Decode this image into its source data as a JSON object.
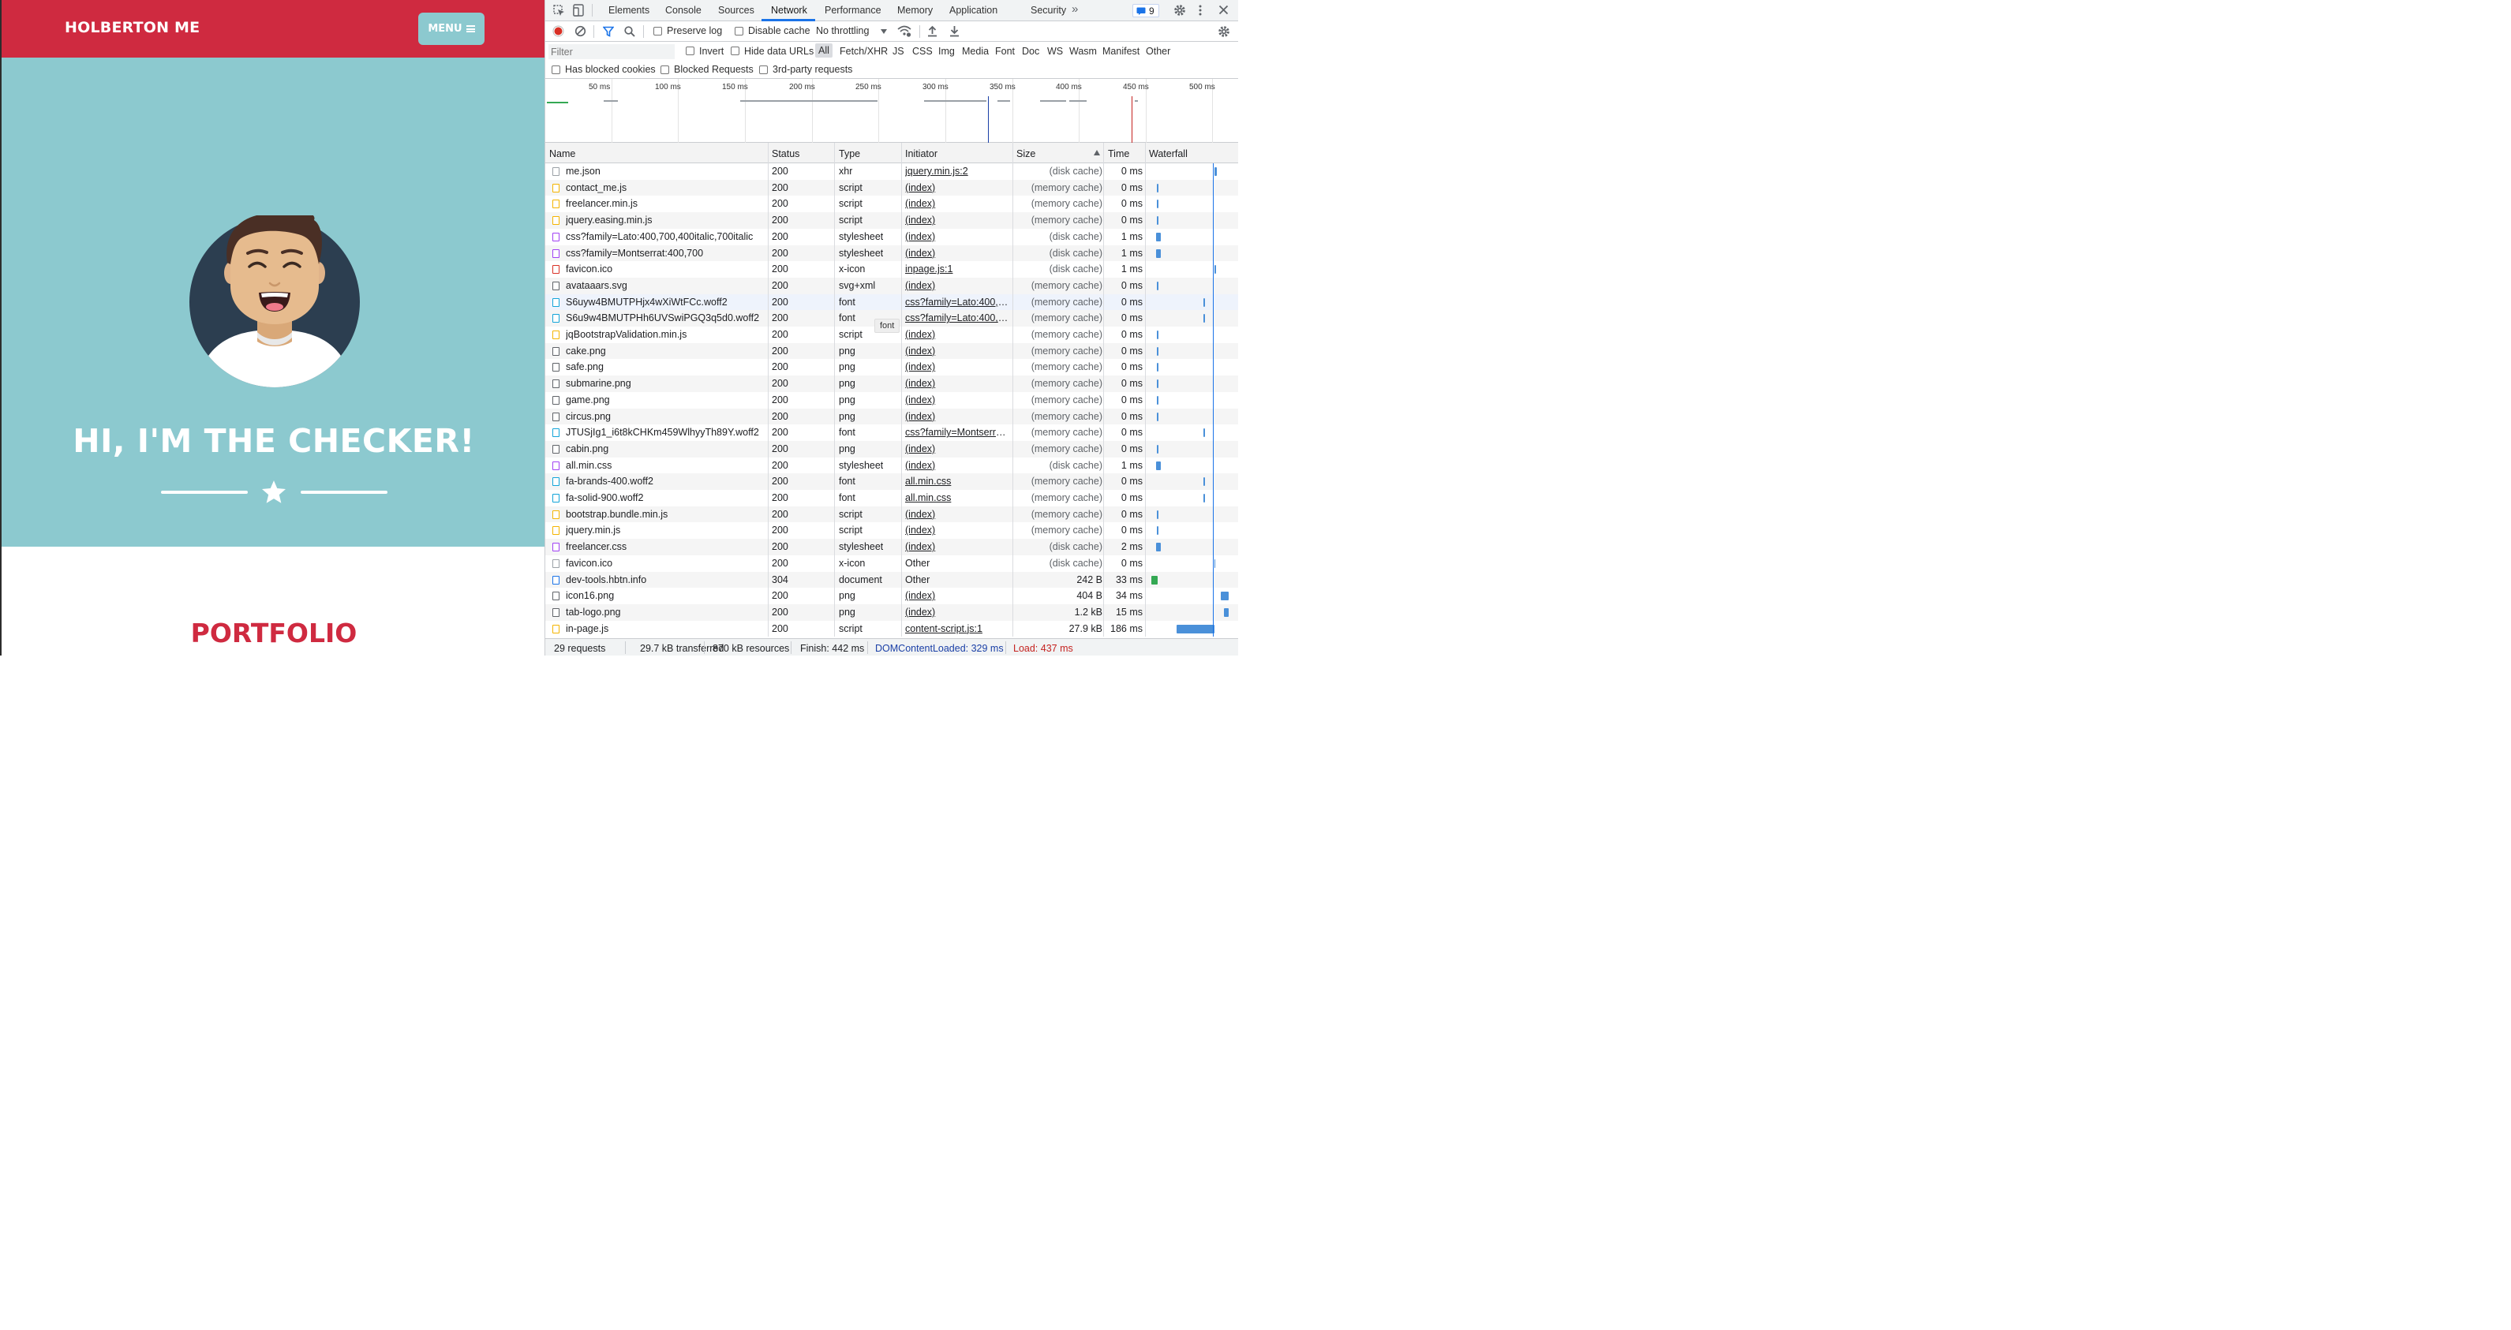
{
  "site": {
    "brand": "HOLBERTON ME",
    "menu_label": "MENU",
    "hero_title": "HI, I'M THE CHECKER!",
    "portfolio_title": "PORTFOLIO",
    "colors": {
      "primary": "#cf2a40",
      "hero_bg": "#8cc9cf"
    }
  },
  "devtools": {
    "tabs": [
      "Elements",
      "Console",
      "Sources",
      "Network",
      "Performance",
      "Memory",
      "Application",
      "Security"
    ],
    "active_tab": "Network",
    "issues_count": "9",
    "toolbar": {
      "preserve_log": "Preserve log",
      "disable_cache": "Disable cache",
      "throttling": "No throttling"
    },
    "filter": {
      "placeholder": "Filter",
      "invert": "Invert",
      "hide_data_urls": "Hide data URLs",
      "types": [
        "All",
        "Fetch/XHR",
        "JS",
        "CSS",
        "Img",
        "Media",
        "Font",
        "Doc",
        "WS",
        "Wasm",
        "Manifest",
        "Other"
      ],
      "has_blocked_cookies": "Has blocked cookies",
      "blocked_requests": "Blocked Requests",
      "third_party": "3rd-party requests"
    },
    "overview_ticks": [
      "50 ms",
      "100 ms",
      "150 ms",
      "200 ms",
      "250 ms",
      "300 ms",
      "350 ms",
      "400 ms",
      "450 ms",
      "500 ms"
    ],
    "columns": {
      "name": "Name",
      "status": "Status",
      "type": "Type",
      "initiator": "Initiator",
      "size": "Size",
      "time": "Time",
      "waterfall": "Waterfall"
    },
    "tooltip": "font",
    "requests": [
      {
        "name": "me.json",
        "status": "200",
        "type": "xhr",
        "initiator": "jquery.min.js:2",
        "size": "(disk cache)",
        "time": "0 ms",
        "icon": "doc-icon"
      },
      {
        "name": "contact_me.js",
        "status": "200",
        "type": "script",
        "initiator": "(index)",
        "size": "(memory cache)",
        "time": "0 ms",
        "icon": "script-icon"
      },
      {
        "name": "freelancer.min.js",
        "status": "200",
        "type": "script",
        "initiator": "(index)",
        "size": "(memory cache)",
        "time": "0 ms",
        "icon": "script-icon"
      },
      {
        "name": "jquery.easing.min.js",
        "status": "200",
        "type": "script",
        "initiator": "(index)",
        "size": "(memory cache)",
        "time": "0 ms",
        "icon": "script-icon"
      },
      {
        "name": "css?family=Lato:400,700,400italic,700italic",
        "status": "200",
        "type": "stylesheet",
        "initiator": "(index)",
        "size": "(disk cache)",
        "time": "1 ms",
        "icon": "stylesheet-icon"
      },
      {
        "name": "css?family=Montserrat:400,700",
        "status": "200",
        "type": "stylesheet",
        "initiator": "(index)",
        "size": "(disk cache)",
        "time": "1 ms",
        "icon": "stylesheet-icon"
      },
      {
        "name": "favicon.ico",
        "status": "200",
        "type": "x-icon",
        "initiator": "inpage.js:1",
        "size": "(disk cache)",
        "time": "1 ms",
        "icon": "favicon-icon"
      },
      {
        "name": "avataaars.svg",
        "status": "200",
        "type": "svg+xml",
        "initiator": "(index)",
        "size": "(memory cache)",
        "time": "0 ms",
        "icon": "image-icon"
      },
      {
        "name": "S6uyw4BMUTPHjx4wXiWtFCc.woff2",
        "status": "200",
        "type": "font",
        "initiator": "css?family=Lato:400,7…",
        "size": "(memory cache)",
        "time": "0 ms",
        "icon": "font-icon"
      },
      {
        "name": "S6u9w4BMUTPHh6UVSwiPGQ3q5d0.woff2",
        "status": "200",
        "type": "font",
        "initiator": "css?family=Lato:400,7…",
        "size": "(memory cache)",
        "time": "0 ms",
        "icon": "font-icon"
      },
      {
        "name": "jqBootstrapValidation.min.js",
        "status": "200",
        "type": "script",
        "initiator": "(index)",
        "size": "(memory cache)",
        "time": "0 ms",
        "icon": "script-icon"
      },
      {
        "name": "cake.png",
        "status": "200",
        "type": "png",
        "initiator": "(index)",
        "size": "(memory cache)",
        "time": "0 ms",
        "icon": "image-icon"
      },
      {
        "name": "safe.png",
        "status": "200",
        "type": "png",
        "initiator": "(index)",
        "size": "(memory cache)",
        "time": "0 ms",
        "icon": "image-icon"
      },
      {
        "name": "submarine.png",
        "status": "200",
        "type": "png",
        "initiator": "(index)",
        "size": "(memory cache)",
        "time": "0 ms",
        "icon": "image-icon"
      },
      {
        "name": "game.png",
        "status": "200",
        "type": "png",
        "initiator": "(index)",
        "size": "(memory cache)",
        "time": "0 ms",
        "icon": "image-icon"
      },
      {
        "name": "circus.png",
        "status": "200",
        "type": "png",
        "initiator": "(index)",
        "size": "(memory cache)",
        "time": "0 ms",
        "icon": "image-icon"
      },
      {
        "name": "JTUSjIg1_i6t8kCHKm459WlhyyTh89Y.woff2",
        "status": "200",
        "type": "font",
        "initiator": "css?family=Montserra…",
        "size": "(memory cache)",
        "time": "0 ms",
        "icon": "font-icon"
      },
      {
        "name": "cabin.png",
        "status": "200",
        "type": "png",
        "initiator": "(index)",
        "size": "(memory cache)",
        "time": "0 ms",
        "icon": "image-icon"
      },
      {
        "name": "all.min.css",
        "status": "200",
        "type": "stylesheet",
        "initiator": "(index)",
        "size": "(disk cache)",
        "time": "1 ms",
        "icon": "stylesheet-icon"
      },
      {
        "name": "fa-brands-400.woff2",
        "status": "200",
        "type": "font",
        "initiator": "all.min.css",
        "size": "(memory cache)",
        "time": "0 ms",
        "icon": "font-icon"
      },
      {
        "name": "fa-solid-900.woff2",
        "status": "200",
        "type": "font",
        "initiator": "all.min.css",
        "size": "(memory cache)",
        "time": "0 ms",
        "icon": "font-icon"
      },
      {
        "name": "bootstrap.bundle.min.js",
        "status": "200",
        "type": "script",
        "initiator": "(index)",
        "size": "(memory cache)",
        "time": "0 ms",
        "icon": "script-icon"
      },
      {
        "name": "jquery.min.js",
        "status": "200",
        "type": "script",
        "initiator": "(index)",
        "size": "(memory cache)",
        "time": "0 ms",
        "icon": "script-icon"
      },
      {
        "name": "freelancer.css",
        "status": "200",
        "type": "stylesheet",
        "initiator": "(index)",
        "size": "(disk cache)",
        "time": "2 ms",
        "icon": "stylesheet-icon"
      },
      {
        "name": "favicon.ico",
        "status": "200",
        "type": "x-icon",
        "initiator": "Other",
        "size": "(disk cache)",
        "time": "0 ms",
        "icon": "doc-icon"
      },
      {
        "name": "dev-tools.hbtn.info",
        "status": "304",
        "type": "document",
        "initiator": "Other",
        "size": "242 B",
        "time": "33 ms",
        "icon": "document-icon"
      },
      {
        "name": "icon16.png",
        "status": "200",
        "type": "png",
        "initiator": "(index)",
        "size": "404 B",
        "time": "34 ms",
        "icon": "image-icon"
      },
      {
        "name": "tab-logo.png",
        "status": "200",
        "type": "png",
        "initiator": "(index)",
        "size": "1.2 kB",
        "time": "15 ms",
        "icon": "image-icon"
      },
      {
        "name": "in-page.js",
        "status": "200",
        "type": "script",
        "initiator": "content-script.js:1",
        "size": "27.9 kB",
        "time": "186 ms",
        "icon": "script-icon"
      }
    ],
    "summary": {
      "requests": "29 requests",
      "transferred": "29.7 kB transferred",
      "resources": "870 kB resources",
      "finish": "Finish: 442 ms",
      "dom_loaded": "DOMContentLoaded: 329 ms",
      "load": "Load: 437 ms"
    }
  }
}
